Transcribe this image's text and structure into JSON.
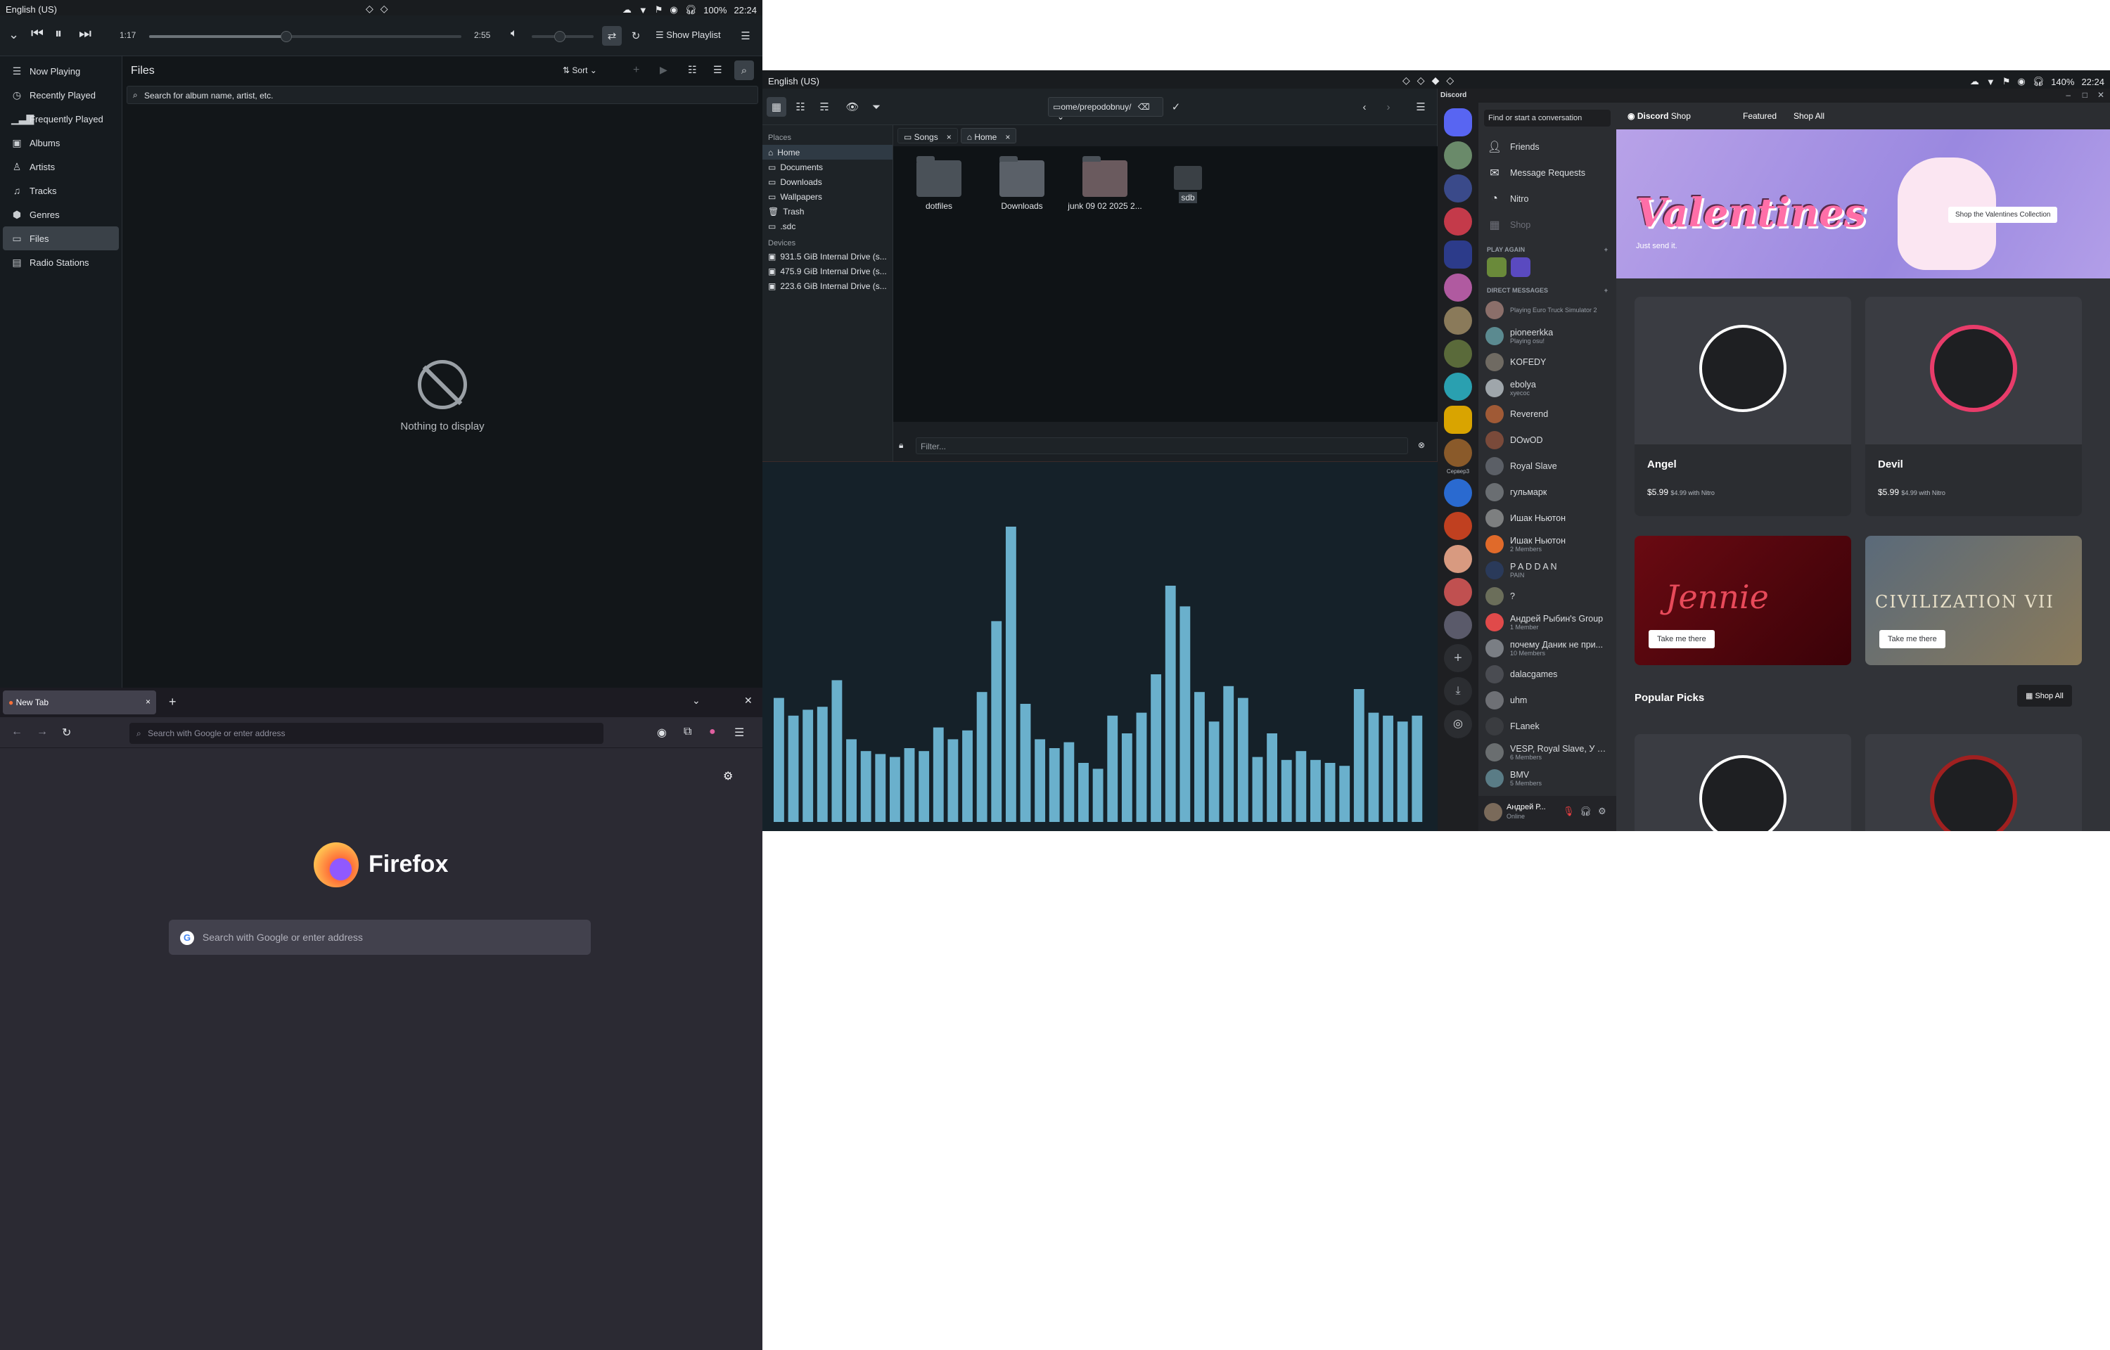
{
  "left_topbar": {
    "lang": "English (US)",
    "battery": "100%",
    "time": "22:24"
  },
  "right_topbar": {
    "lang": "English (US)",
    "battery": "140%",
    "time": "22:24"
  },
  "music": {
    "elapsed": "1:17",
    "total": "2:55",
    "progress": 0.44,
    "volume": 0.45,
    "show_playlist": "Show Playlist",
    "sidebar": [
      "Now Playing",
      "Recently Played",
      "Frequently Played",
      "Albums",
      "Artists",
      "Tracks",
      "Genres",
      "Files",
      "Radio Stations"
    ],
    "active": "Files",
    "header": "Files",
    "sort": "Sort",
    "search_placeholder": "Search for album name, artist, etc.",
    "empty": "Nothing to display"
  },
  "files": {
    "path": "ome/prepodobnuy/",
    "places_label": "Places",
    "places": [
      "Home",
      "Documents",
      "Downloads",
      "Wallpapers",
      "Trash",
      ".sdc"
    ],
    "devices_label": "Devices",
    "devices": [
      "931.5 GiB Internal Drive (s...",
      "475.9 GiB Internal Drive (s...",
      "223.6 GiB Internal Drive (s..."
    ],
    "tabs": [
      "Songs",
      "Home"
    ],
    "items": [
      "dotfiles",
      "Downloads",
      "junk 09 02 2025 2...",
      "sdb"
    ],
    "filter_placeholder": "Filter..."
  },
  "visualizer": {
    "bars": [
      0.42,
      0.36,
      0.38,
      0.39,
      0.48,
      0.28,
      0.24,
      0.23,
      0.22,
      0.25,
      0.24,
      0.32,
      0.28,
      0.31,
      0.44,
      0.68,
      1.0,
      0.4,
      0.28,
      0.25,
      0.27,
      0.2,
      0.18,
      0.36,
      0.3,
      0.37,
      0.5,
      0.8,
      0.73,
      0.44,
      0.34,
      0.46,
      0.42,
      0.22,
      0.3,
      0.21,
      0.24,
      0.21,
      0.2,
      0.19,
      0.45,
      0.37,
      0.36,
      0.34,
      0.36
    ]
  },
  "discord": {
    "brand": "Discord",
    "search": "Find or start a conversation",
    "nav": [
      "Friends",
      "Message Requests",
      "Nitro",
      "Shop"
    ],
    "play_again": "PLAY AGAIN",
    "direct_messages": "DIRECT MESSAGES",
    "dms": [
      {
        "name": "",
        "sub": "Playing Euro Truck Simulator 2",
        "color": "#8b6f6a"
      },
      {
        "name": "pioneerkka",
        "sub": "Playing osu! ",
        "color": "#5b8a90"
      },
      {
        "name": "KOFEDY",
        "sub": "",
        "color": "#6f6a62"
      },
      {
        "name": "ebolya",
        "sub": "хуесос",
        "color": "#9fa6ab"
      },
      {
        "name": "Reverend",
        "sub": "",
        "color": "#a05a36"
      },
      {
        "name": "DOwOD",
        "sub": "",
        "color": "#7a4a3a"
      },
      {
        "name": "Royal Slave",
        "sub": "",
        "color": "#5b5f66"
      },
      {
        "name": "гульмарк",
        "sub": "",
        "color": "#6a6e72"
      },
      {
        "name": "Ишак Ньютон",
        "sub": "",
        "color": "#7d7f80"
      },
      {
        "name": "Ишак Ньютон",
        "sub": "2 Members",
        "color": "#e06a2a"
      },
      {
        "name": "P A D D A N",
        "sub": "PAIN",
        "color": "#2a3a5a"
      },
      {
        "name": "?",
        "sub": "",
        "color": "#6b6e5a"
      },
      {
        "name": "Андрей Рыбин's Group",
        "sub": "1 Member",
        "color": "#e04a4a"
      },
      {
        "name": "почему Даник не при...",
        "sub": "10 Members",
        "color": "#7a7e84"
      },
      {
        "name": "dalacgames",
        "sub": "",
        "color": "#4a4c52"
      },
      {
        "name": "uhm",
        "sub": "",
        "color": "#6e7075"
      },
      {
        "name": "FLanek",
        "sub": "",
        "color": "#3a3c40"
      },
      {
        "name": "VESP, Royal Slave, У м...",
        "sub": "6 Members",
        "color": "#6a6e70"
      },
      {
        "name": "BMV",
        "sub": "5 Members",
        "color": "#5a7c86"
      }
    ],
    "user": {
      "name": "Андрей Р...",
      "status": "Online"
    },
    "shop_tabs": [
      "Featured",
      "Shop All"
    ],
    "shop_title": "Shop",
    "banner_title": "Valentines",
    "banner_sub": "Just send it.",
    "banner_btn": "Shop the Valentines Collection",
    "cards": [
      {
        "name": "Angel",
        "price": "$5.99",
        "nitro": "$4.99 with Nitro"
      },
      {
        "name": "Devil",
        "price": "$5.99",
        "nitro": "$4.99 with Nitro"
      }
    ],
    "promo_btn": "Take me there",
    "promos": [
      "Jennie",
      "CIVILIZATION VII"
    ],
    "popular": "Popular Picks",
    "shop_all": "Shop All",
    "guild_label": "Сервер3"
  },
  "firefox": {
    "tab": "New Tab",
    "url_placeholder": "Search with Google or enter address",
    "logo_text": "Firefox",
    "search_placeholder": "Search with Google or enter address"
  },
  "colors": {
    "accent_music": "#3a4148",
    "visualizer": "#6ab0cc",
    "discord_purple": "#5865f2"
  }
}
